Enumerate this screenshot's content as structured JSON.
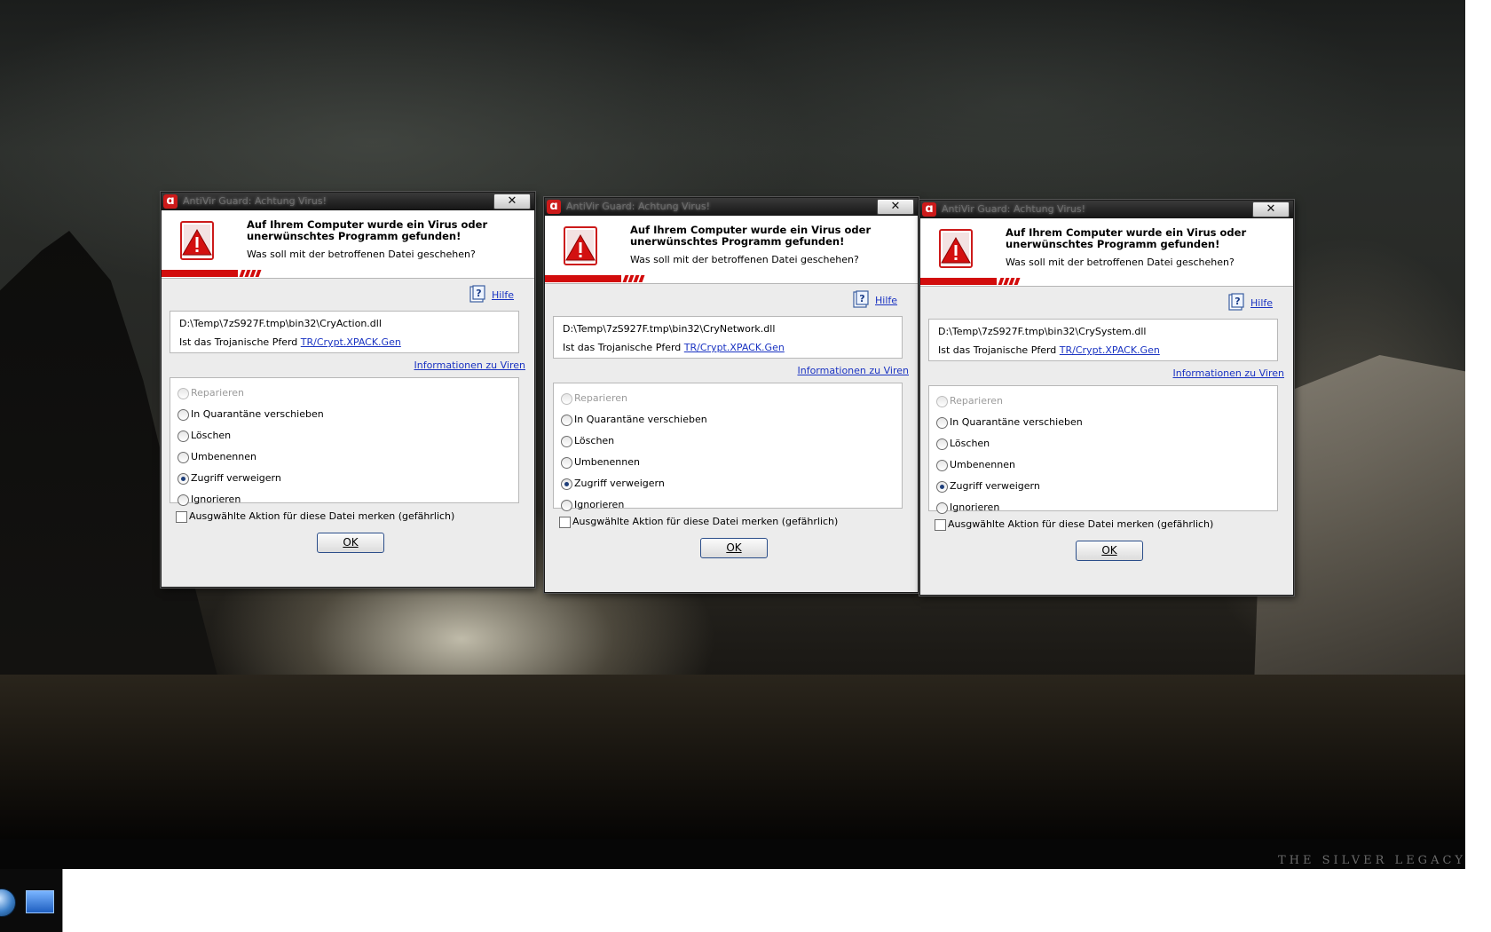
{
  "desktop": {
    "brand": "THE SILVER LEGACY™"
  },
  "dialogs": [
    {
      "title": "AntiVir Guard: Achtung Virus!",
      "headline": "Auf Ihrem Computer wurde ein Virus oder unerwünschtes Programm gefunden!",
      "subline": "Was soll mit der betroffenen Datei geschehen?",
      "help": "Hilfe",
      "file_path": "D:\\Temp\\7zS927F.tmp\\bin32\\CryAction.dll",
      "virus_prefix": "Ist das Trojanische Pferd",
      "virus_name": "TR/Crypt.XPACK.Gen",
      "info_link": "Informationen zu Viren",
      "options": [
        {
          "label": "Reparieren",
          "disabled": true,
          "checked": false
        },
        {
          "label": "In Quarantäne verschieben",
          "disabled": false,
          "checked": false
        },
        {
          "label": "Löschen",
          "disabled": false,
          "checked": false
        },
        {
          "label": "Umbenennen",
          "disabled": false,
          "checked": false
        },
        {
          "label": "Zugriff verweigern",
          "disabled": false,
          "checked": true
        },
        {
          "label": "Ignorieren",
          "disabled": false,
          "checked": false
        }
      ],
      "remember": "Ausgwählte Aktion für diese Datei merken (gefährlich)",
      "ok": "OK"
    },
    {
      "title": "AntiVir Guard: Achtung Virus!",
      "headline": "Auf Ihrem Computer wurde ein Virus oder unerwünschtes Programm gefunden!",
      "subline": "Was soll mit der betroffenen Datei geschehen?",
      "help": "Hilfe",
      "file_path": "D:\\Temp\\7zS927F.tmp\\bin32\\CryNetwork.dll",
      "virus_prefix": "Ist das Trojanische Pferd",
      "virus_name": "TR/Crypt.XPACK.Gen",
      "info_link": "Informationen zu Viren",
      "options": [
        {
          "label": "Reparieren",
          "disabled": true,
          "checked": false
        },
        {
          "label": "In Quarantäne verschieben",
          "disabled": false,
          "checked": false
        },
        {
          "label": "Löschen",
          "disabled": false,
          "checked": false
        },
        {
          "label": "Umbenennen",
          "disabled": false,
          "checked": false
        },
        {
          "label": "Zugriff verweigern",
          "disabled": false,
          "checked": true
        },
        {
          "label": "Ignorieren",
          "disabled": false,
          "checked": false
        }
      ],
      "remember": "Ausgwählte Aktion für diese Datei merken (gefährlich)",
      "ok": "OK"
    },
    {
      "title": "AntiVir Guard: Achtung Virus!",
      "headline": "Auf Ihrem Computer wurde ein Virus oder unerwünschtes Programm gefunden!",
      "subline": "Was soll mit der betroffenen Datei geschehen?",
      "help": "Hilfe",
      "file_path": "D:\\Temp\\7zS927F.tmp\\bin32\\CrySystem.dll",
      "virus_prefix": "Ist das Trojanische Pferd",
      "virus_name": "TR/Crypt.XPACK.Gen",
      "info_link": "Informationen zu Viren",
      "options": [
        {
          "label": "Reparieren",
          "disabled": true,
          "checked": false
        },
        {
          "label": "In Quarantäne verschieben",
          "disabled": false,
          "checked": false
        },
        {
          "label": "Löschen",
          "disabled": false,
          "checked": false
        },
        {
          "label": "Umbenennen",
          "disabled": false,
          "checked": false
        },
        {
          "label": "Zugriff verweigern",
          "disabled": false,
          "checked": true
        },
        {
          "label": "Ignorieren",
          "disabled": false,
          "checked": false
        }
      ],
      "remember": "Ausgwählte Aktion für diese Datei merken (gefährlich)",
      "ok": "OK"
    }
  ],
  "colors": {
    "accent_red": "#d20c0c",
    "link_blue": "#1a33c2"
  },
  "icons": {
    "app": "avira-umbrella-icon",
    "warning": "warning-triangle-icon",
    "help": "help-book-icon",
    "close": "close-icon"
  }
}
